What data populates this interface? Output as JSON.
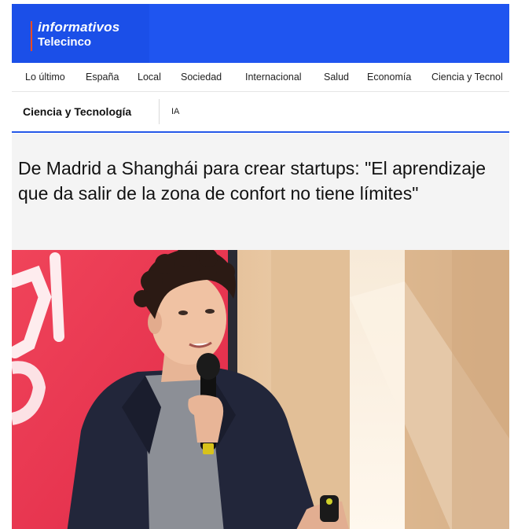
{
  "brand": {
    "line1": "informativos",
    "line2": "Telecinco",
    "accent_color": "#1f55f0",
    "logo_bar_color": "#ff4b1f"
  },
  "nav": {
    "items": [
      "Lo último",
      "España",
      "Local",
      "Sociedad",
      "Internacional",
      "Salud",
      "Economía",
      "Ciencia y Tecnol"
    ]
  },
  "section": {
    "title": "Ciencia y Tecnología",
    "tag": "IA"
  },
  "article": {
    "headline": "De Madrid a Shanghái para crear startups: \"El aprendizaje que da salir de la zona de confort no tiene límites\""
  }
}
